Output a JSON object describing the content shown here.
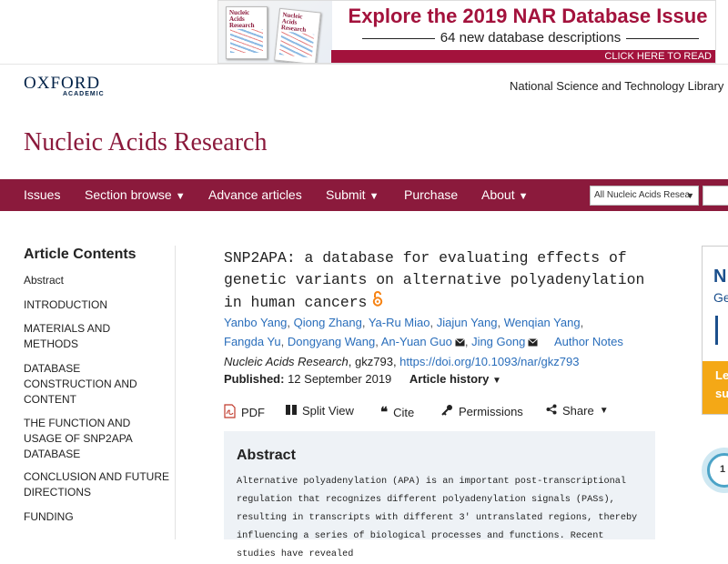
{
  "banner": {
    "title": "Explore the 2019 NAR Database Issue",
    "subtitle": "64 new database descriptions",
    "cta": "CLICK HERE TO READ",
    "magazine_title": "Nucleic Acids Research"
  },
  "header": {
    "logo_main": "OXFORD",
    "logo_sub": "ACADEMIC",
    "institution": "National Science and Technology Library"
  },
  "journal": {
    "title": "Nucleic Acids Research"
  },
  "nav": {
    "items": [
      {
        "label": "Issues"
      },
      {
        "label": "Section browse"
      },
      {
        "label": "Advance articles"
      },
      {
        "label": "Submit"
      },
      {
        "label": "Purchase"
      },
      {
        "label": "About"
      }
    ],
    "search_scope": "All Nucleic Acids Resea"
  },
  "toc": {
    "heading": "Article Contents",
    "items": [
      "Abstract",
      "INTRODUCTION",
      "MATERIALS AND METHODS",
      "DATABASE CONSTRUCTION AND CONTENT",
      "THE FUNCTION AND USAGE OF SNP2APA DATABASE",
      "CONCLUSION AND FUTURE DIRECTIONS",
      "FUNDING"
    ]
  },
  "article": {
    "title": "SNP2APA: a database for evaluating effects of genetic variants on alternative polyadenylation in human cancers",
    "authors": [
      "Yanbo Yang",
      "Qiong Zhang",
      "Ya-Ru Miao",
      "Jiajun Yang",
      "Wenqian Yang",
      "Fangda Yu",
      "Dongyang Wang",
      "An-Yuan Guo",
      "Jing Gong"
    ],
    "author_notes": "Author Notes",
    "journal_name": "Nucleic Acids Research",
    "article_id": ", gkz793, ",
    "doi": "https://doi.org/10.1093/nar/gkz793",
    "published_label": "Published:",
    "published_date": "12 September 2019",
    "history_label": "Article history"
  },
  "tools": {
    "pdf": "PDF",
    "split": "Split View",
    "cite": "Cite",
    "permissions": "Permissions",
    "share": "Share"
  },
  "abstract": {
    "heading": "Abstract",
    "text": "Alternative polyadenylation (APA) is an important post-transcriptional regulation that recognizes different polyadenylation signals (PASs), resulting in transcripts with different 3′ untranslated regions, thereby influencing a series of biological processes and functions. Recent studies have revealed"
  },
  "right_ad": {
    "line1": "N",
    "line2": "Ge",
    "yellow1": "Le",
    "yellow2": "su"
  },
  "badge": {
    "label": "1"
  },
  "colors": {
    "brand": "#8b1a3c",
    "link": "#2a6ebb",
    "banner_accent": "#a3123c",
    "abstract_bg": "#eef2f6"
  }
}
